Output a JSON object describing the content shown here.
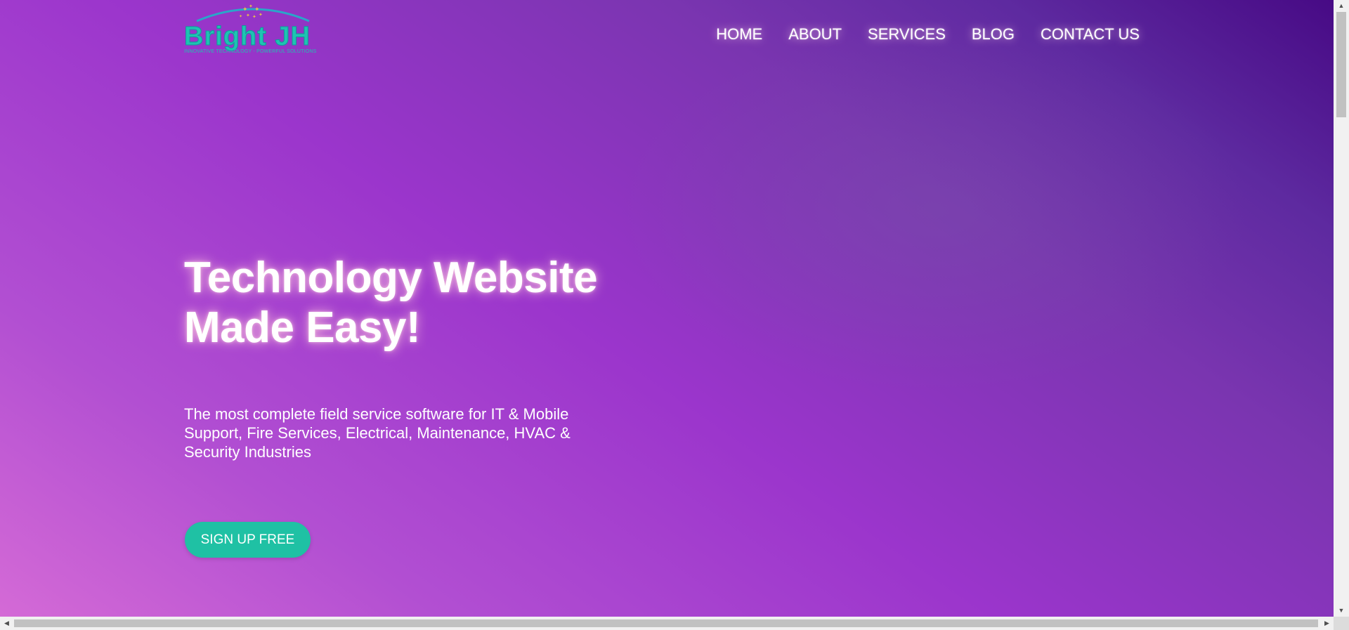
{
  "brand": {
    "name": "Bright JH",
    "tagline": "INNOVATIVE TECHNOLOGY - POWERFUL SOLUTIONS",
    "primary_color": "#1ec3b2"
  },
  "nav": {
    "items": [
      {
        "label": "HOME"
      },
      {
        "label": "ABOUT"
      },
      {
        "label": "SERVICES"
      },
      {
        "label": "BLOG"
      },
      {
        "label": "CONTACT US"
      }
    ]
  },
  "hero": {
    "title": "Technology Website Made Easy!",
    "subtitle": "The most complete field service software for IT & Mobile Support, Fire Services, Electrical, Maintenance, HVAC & Security Industries",
    "cta_label": "SIGN UP FREE",
    "cta_color": "#1fc1a4",
    "background_colors": [
      "#d46ad6",
      "#9b35cc",
      "#470a85"
    ]
  },
  "scrollbars": {
    "up_icon": "▲",
    "down_icon": "▼",
    "left_icon": "◀",
    "right_icon": "▶"
  }
}
